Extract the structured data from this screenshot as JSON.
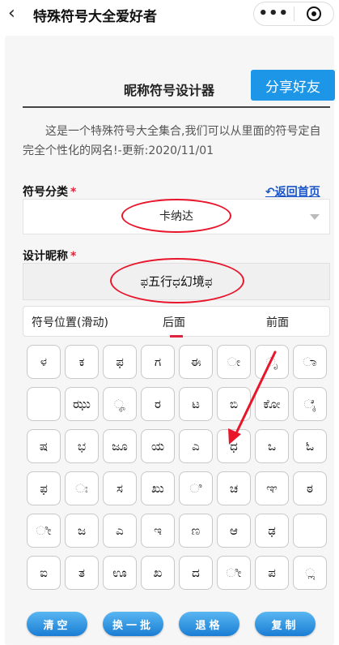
{
  "topbar": {
    "back_icon": "‹",
    "title": "特殊符号大全爱好者",
    "more_icon": "•••"
  },
  "header": {
    "title": "昵称符号设计器",
    "share_label": "分享好友"
  },
  "intro": "这是一个特殊符号大全集合,我们可以从里面的符号定自完全个性化的网名!-更新:2020/11/01",
  "category": {
    "label": "符号分类",
    "required_mark": "*",
    "home_link": "↶返回首页",
    "selected": "卡纳达"
  },
  "nickname": {
    "label": "设计昵称",
    "required_mark": "*",
    "value": "ಫ五行ಧ幻境ಫ"
  },
  "position": {
    "label": "符号位置(滑动)",
    "option_back": "后面",
    "option_front": "前面",
    "selected": "后面"
  },
  "symbols": [
    "ಳ",
    "ಕ",
    "ಫ",
    "ಗ",
    "ಈ",
    "ೕ",
    "ೃ",
    "ಾ",
    "",
    "ಝು",
    "ೄ",
    "ರ",
    "ಟ",
    "ಬಿ",
    "ಕೋ",
    "ೈ",
    "ಷ",
    "ಭ",
    "ಜೂ",
    "ಯ",
    "ಎ",
    "ಧ",
    "ಒ",
    "ಓ",
    "ಫ",
    "ಃ",
    "ಸ",
    "ಖು",
    "ಿ",
    "ಚ",
    "ಞ",
    "ಠ",
    "ೀ",
    "ಜ",
    "ಎ",
    "ಇ",
    "ಣ",
    "ಆ",
    "ಢ",
    "",
    "ಐ",
    "ತ",
    "ಊ",
    "ಖ",
    "ದ",
    "ೀ",
    "ಪ",
    "ೢ"
  ],
  "actions": {
    "clear": "清空",
    "next_batch": "换一批",
    "backspace": "退格",
    "copy": "复制"
  },
  "colors": {
    "accent": "#1e96e8",
    "required": "#e0243e",
    "link": "#1a55c8",
    "annotation": "#e8152b"
  }
}
